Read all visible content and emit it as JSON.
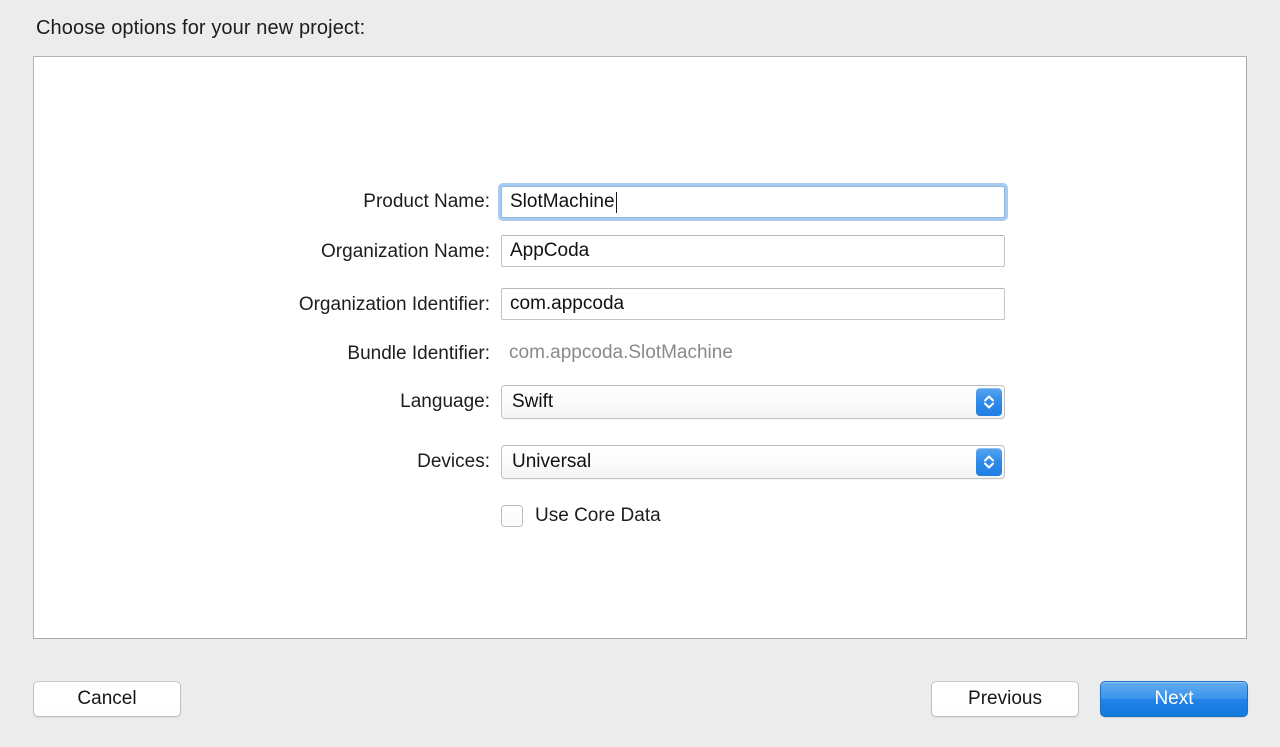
{
  "dialog": {
    "prompt": "Choose options for your new project:"
  },
  "form": {
    "fields": [
      {
        "label": "Product Name:",
        "value": "SlotMachine",
        "type": "text",
        "focused": true
      },
      {
        "label": "Organization Name:",
        "value": "AppCoda",
        "type": "text",
        "focused": false
      },
      {
        "label": "Organization Identifier:",
        "value": "com.appcoda",
        "type": "text",
        "focused": false
      },
      {
        "label": "Bundle Identifier:",
        "value": "com.appcoda.SlotMachine",
        "type": "static",
        "focused": false
      },
      {
        "label": "Language:",
        "value": "Swift",
        "type": "popup",
        "focused": false
      },
      {
        "label": "Devices:",
        "value": "Universal",
        "type": "popup",
        "focused": false
      }
    ],
    "checkbox": {
      "label": "Use Core Data",
      "checked": false
    }
  },
  "buttons": {
    "cancel": "Cancel",
    "previous": "Previous",
    "next": "Next"
  },
  "icons": {
    "stepper": "stepper-up-down-icon"
  },
  "colors": {
    "accent": "#2183e8",
    "focus_ring": "#a8cbf0",
    "window_background": "#ececec",
    "panel_background": "#ffffff",
    "static_text": "#8a8a8a"
  }
}
